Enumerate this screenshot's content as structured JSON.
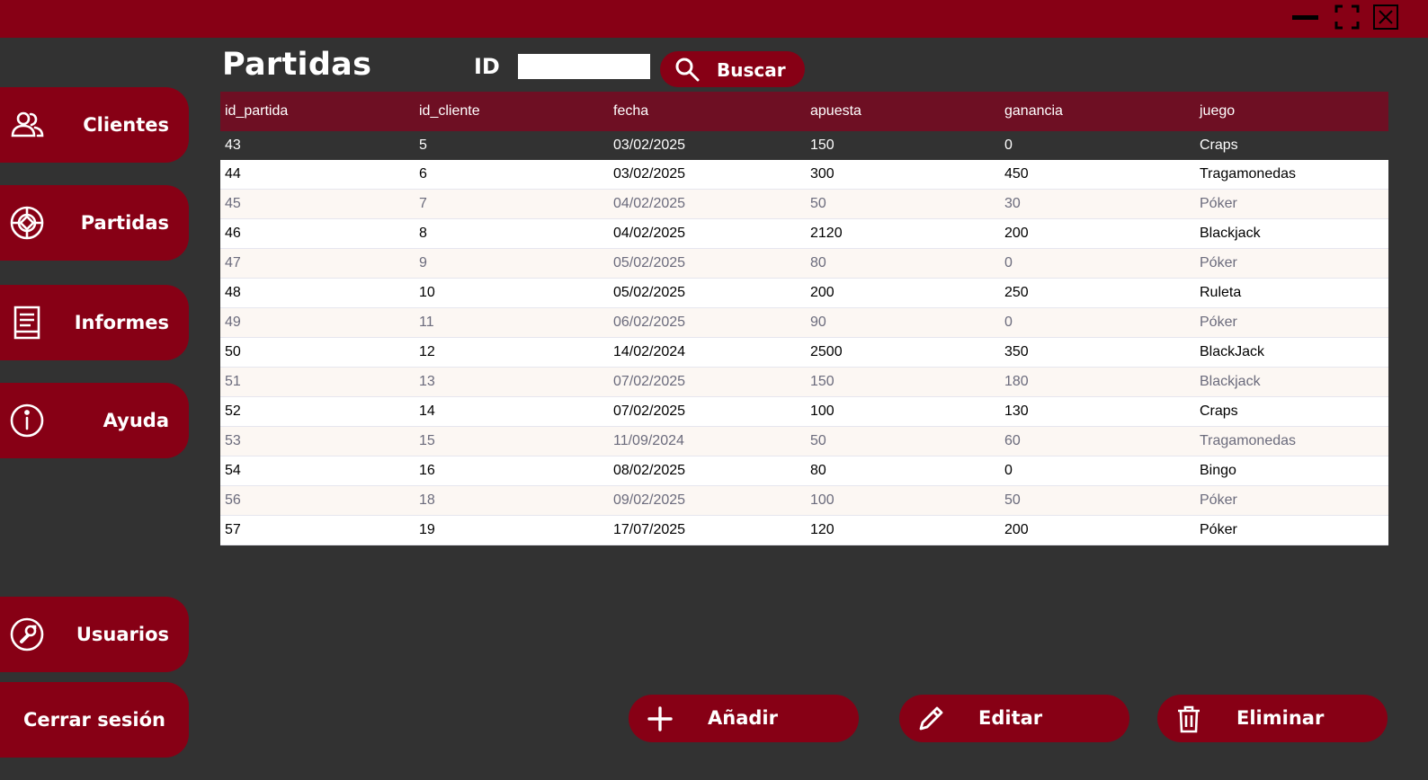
{
  "window": {
    "minimize_icon": "minimize-icon",
    "maximize_icon": "maximize-icon",
    "close_icon": "close-icon"
  },
  "header": {
    "title": "Partidas",
    "id_label": "ID",
    "id_value": "",
    "search_label": "Buscar"
  },
  "sidebar": {
    "items": [
      {
        "label": "Clientes",
        "icon": "users-icon"
      },
      {
        "label": "Partidas",
        "icon": "chip-icon"
      },
      {
        "label": "Informes",
        "icon": "report-icon"
      },
      {
        "label": "Ayuda",
        "icon": "info-icon"
      }
    ],
    "bottom": [
      {
        "label": "Usuarios",
        "icon": "wrench-icon"
      },
      {
        "label": "Cerrar sesión"
      }
    ]
  },
  "table": {
    "columns": [
      "id_partida",
      "id_cliente",
      "fecha",
      "apuesta",
      "ganancia",
      "juego"
    ],
    "rows": [
      [
        "43",
        "5",
        "03/02/2025",
        "150",
        "0",
        "Craps"
      ],
      [
        "44",
        "6",
        "03/02/2025",
        "300",
        "450",
        "Tragamonedas"
      ],
      [
        "45",
        "7",
        "04/02/2025",
        "50",
        "30",
        "Póker"
      ],
      [
        "46",
        "8",
        "04/02/2025",
        "2120",
        "200",
        "Blackjack"
      ],
      [
        "47",
        "9",
        "05/02/2025",
        "80",
        "0",
        "Póker"
      ],
      [
        "48",
        "10",
        "05/02/2025",
        "200",
        "250",
        "Ruleta"
      ],
      [
        "49",
        "11",
        "06/02/2025",
        "90",
        "0",
        "Póker"
      ],
      [
        "50",
        "12",
        "14/02/2024",
        "2500",
        "350",
        "BlackJack"
      ],
      [
        "51",
        "13",
        "07/02/2025",
        "150",
        "180",
        "Blackjack"
      ],
      [
        "52",
        "14",
        "07/02/2025",
        "100",
        "130",
        "Craps"
      ],
      [
        "53",
        "15",
        "11/09/2024",
        "50",
        "60",
        "Tragamonedas"
      ],
      [
        "54",
        "16",
        "08/02/2025",
        "80",
        "0",
        "Bingo"
      ],
      [
        "56",
        "18",
        "09/02/2025",
        "100",
        "50",
        "Póker"
      ],
      [
        "57",
        "19",
        "17/07/2025",
        "120",
        "200",
        "Póker"
      ]
    ],
    "selected_row": 0
  },
  "actions": {
    "add_label": "Añadir",
    "edit_label": "Editar",
    "delete_label": "Eliminar"
  },
  "colors": {
    "accent": "#870015",
    "header": "#6e0f23",
    "background": "#323232"
  }
}
